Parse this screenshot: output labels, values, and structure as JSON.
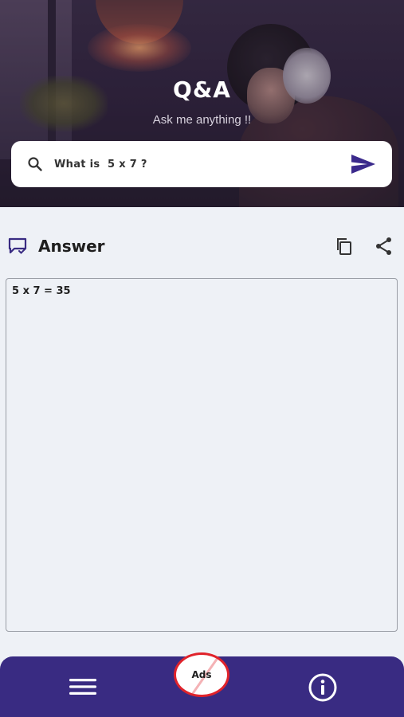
{
  "header": {
    "title": "Q&A",
    "subtitle": "Ask me anything !!"
  },
  "search": {
    "query": "What is  5 x 7 ?",
    "icon": "search-icon",
    "send_icon": "send-icon"
  },
  "answer": {
    "label": "Answer",
    "text": "5 x 7 = 35",
    "icons": [
      "chat-check-icon",
      "copy-icon",
      "share-icon"
    ]
  },
  "bottom_nav": {
    "menu_icon": "menu-icon",
    "ads_label": "Ads",
    "info_icon": "info-icon"
  },
  "colors": {
    "primary": "#392b82",
    "send": "#3b2a8c",
    "ads_ring": "#e0232b",
    "background": "#eef1f6"
  }
}
